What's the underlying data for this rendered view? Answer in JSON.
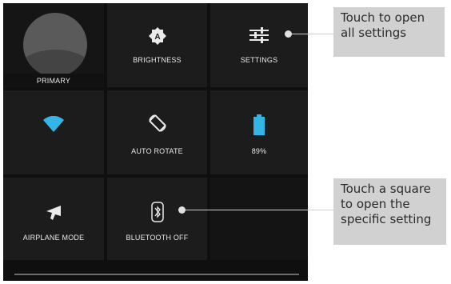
{
  "tiles": {
    "primary": {
      "label": "PRIMARY",
      "icon": "user-avatar-icon"
    },
    "brightness": {
      "label": "BRIGHTNESS",
      "icon": "brightness-auto-icon"
    },
    "settings": {
      "label": "SETTINGS",
      "icon": "sliders-icon"
    },
    "wifi": {
      "label": "",
      "icon": "wifi-icon",
      "accent": "#33b5e5"
    },
    "auto_rotate": {
      "label": "AUTO ROTATE",
      "icon": "rotate-icon"
    },
    "battery": {
      "label": "89%",
      "icon": "battery-icon",
      "level": 0.89,
      "accent": "#33b5e5"
    },
    "airplane": {
      "label": "AIRPLANE MODE",
      "icon": "airplane-icon"
    },
    "bluetooth": {
      "label": "BLUETOOTH OFF",
      "icon": "bluetooth-off-icon"
    }
  },
  "callouts": {
    "settings_hint": "Touch to open all settings",
    "tile_hint": "Touch a square to open the specific setting"
  }
}
